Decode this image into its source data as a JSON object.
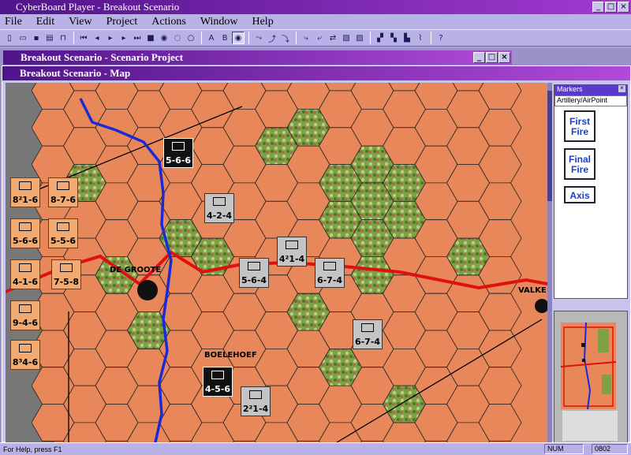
{
  "app": {
    "title": "CyberBoard Player - Breakout Scenario"
  },
  "menu": [
    "File",
    "Edit",
    "View",
    "Project",
    "Actions",
    "Window",
    "Help"
  ],
  "toolbar": {
    "icons": [
      "new-icon",
      "open-icon",
      "save-icon",
      "print-icon",
      "lock-icon",
      "first-icon",
      "prev-icon",
      "play-icon",
      "next-icon",
      "last-icon",
      "stop-icon",
      "record-icon",
      "bubble-icon",
      "bubble2-icon",
      "bubble3-icon",
      "text-a-icon",
      "text-b-icon",
      "eye-icon",
      "move-icon",
      "plot-icon",
      "rotate-icon",
      "flip-icon",
      "grid-icon",
      "zoom-icon",
      "layer-icon",
      "stack-icon",
      "help-icon"
    ]
  },
  "windows": {
    "project_title": "Breakout Scenario - Scenario Project",
    "map_title": "Breakout Scenario - Map"
  },
  "map": {
    "places": [
      {
        "name": "DE GROOTE"
      },
      {
        "name": "BOELEHOEF"
      },
      {
        "name": "VALKE"
      }
    ],
    "counters": [
      {
        "label": "5-6-6",
        "style": "black"
      },
      {
        "label": "4-2-4",
        "style": "grey"
      },
      {
        "label": "4²1-4",
        "style": "grey"
      },
      {
        "label": "5-6-4",
        "style": "grey"
      },
      {
        "label": "6-7-4",
        "style": "grey"
      },
      {
        "label": "6-7-4",
        "style": "grey"
      },
      {
        "label": "4-5-6",
        "style": "black"
      },
      {
        "label": "2²1-4",
        "style": "grey"
      },
      {
        "label": "8²1-6",
        "style": "orange"
      },
      {
        "label": "8-7-6",
        "style": "orange"
      },
      {
        "label": "5-6-6",
        "style": "orange"
      },
      {
        "label": "5-5-6",
        "style": "orange"
      },
      {
        "label": "4-1-6",
        "style": "orange"
      },
      {
        "label": "7-5-8",
        "style": "orange"
      },
      {
        "label": "9-4-6",
        "style": "orange"
      },
      {
        "label": "8³4-6",
        "style": "orange"
      }
    ]
  },
  "markers": {
    "header": "Markers",
    "category": "Artillery/AirPoint",
    "items": [
      {
        "label": "First\nFire"
      },
      {
        "label": "Final\nFire"
      },
      {
        "label": "Axis"
      }
    ]
  },
  "status": {
    "help": "For Help, press F1",
    "num": "NUM",
    "code": "0802"
  },
  "colors": {
    "hex": "#e8875a",
    "woods": "#7fa045",
    "river": "#1a2ad8",
    "road": "#e01010",
    "title": "#50148a"
  }
}
